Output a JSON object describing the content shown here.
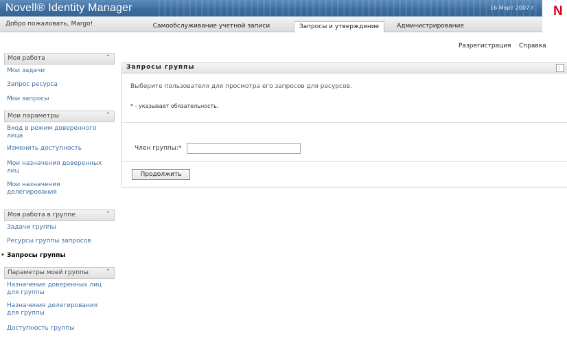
{
  "header": {
    "brand": "Novell® Identity Manager",
    "date": "16 Март 2007 г.",
    "logo": "N",
    "welcome": "Добро пожаловать, Margo!",
    "tabs": [
      {
        "label": "Самообслуживание учетной записи",
        "active": false
      },
      {
        "label": "Запросы и утверждение",
        "active": true
      },
      {
        "label": "Администрирование",
        "active": false
      }
    ],
    "links": {
      "logout": "Разрегистрация",
      "help": "Справка"
    }
  },
  "sidebar": {
    "sections": [
      {
        "title": "Моя работа",
        "items": [
          "Мои задачи",
          "Запрос ресурса",
          "Мои запросы"
        ]
      },
      {
        "title": "Мои параметры",
        "items": [
          "Вход в режим доверенного лица",
          "Изменить доступность",
          "Мои назначения доверенных лиц",
          "Мои назначения делегирования"
        ]
      },
      {
        "title": "Моя работа в группе",
        "items": [
          "Задачи группы",
          "Ресурсы группы запросов",
          "Запросы группы"
        ]
      },
      {
        "title": "Параметры моей группы",
        "items": [
          "Назначение доверенных лиц для группы",
          "Назначения делегирования для группы",
          "Доступность группы"
        ]
      }
    ],
    "active_item": "Запросы группы",
    "collapse_icon": "double-chevron-up-icon"
  },
  "main": {
    "title": "Запросы группы",
    "description": "Выберите пользователя для просмотра его запросов для ресурсов.",
    "required_note": "* - указывает обязательность.",
    "field_label": "Член группы:*",
    "field_value": "",
    "button": "Продолжить",
    "panel_icon": "expand-icon"
  },
  "colors": {
    "banner": "#3c6c9e",
    "link": "#3d6ea6",
    "logo": "#d0021b"
  }
}
